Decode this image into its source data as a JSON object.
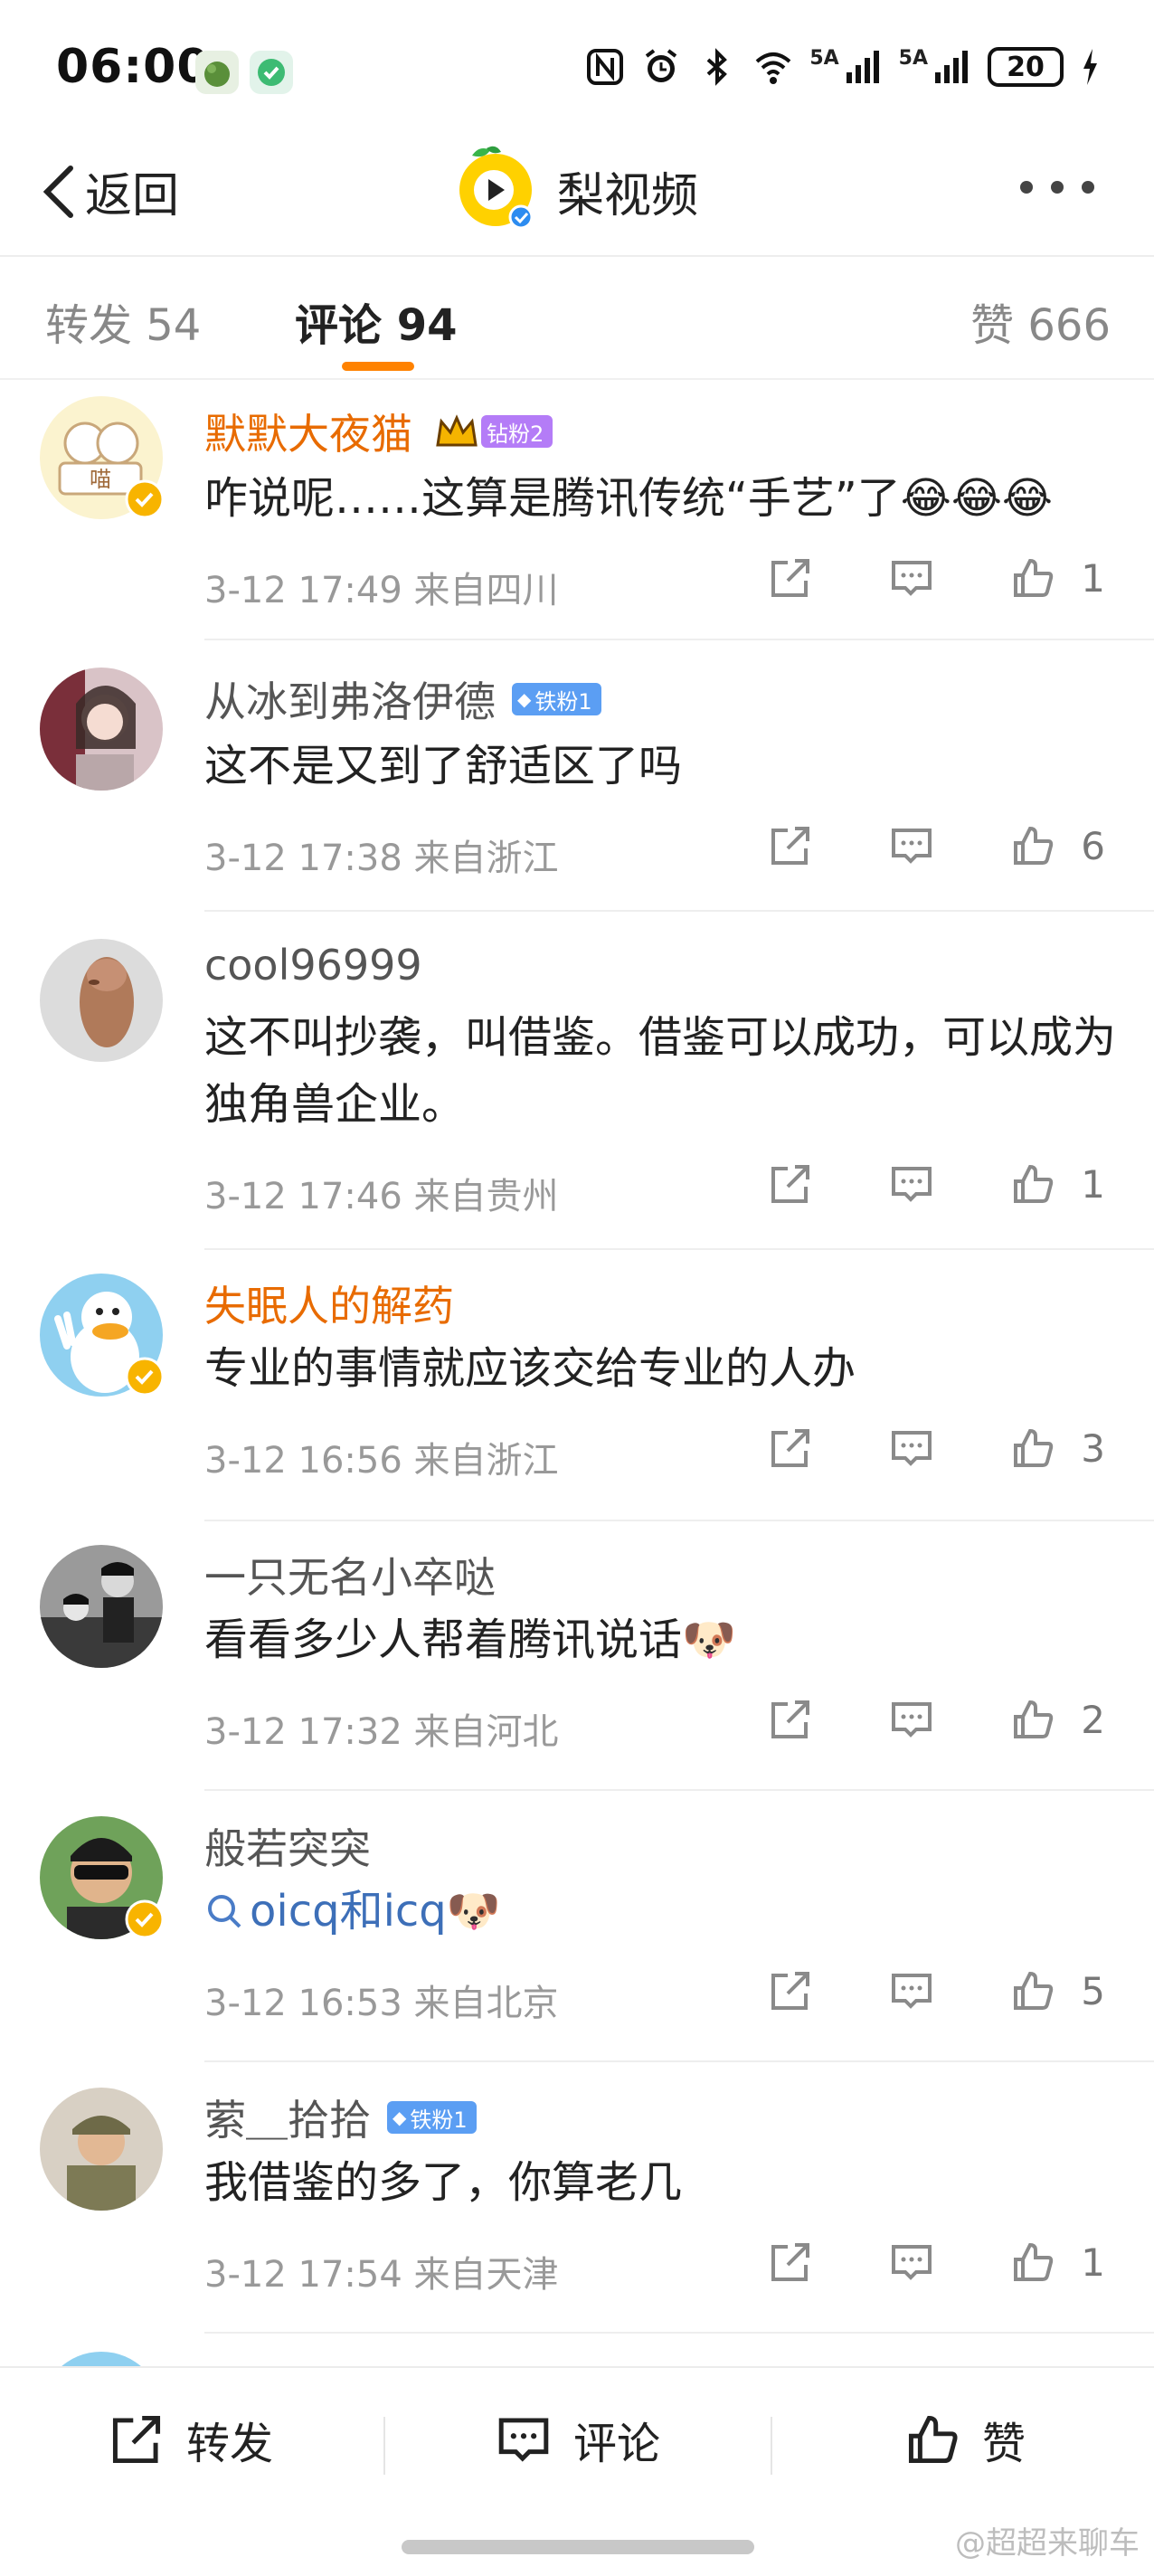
{
  "status_bar": {
    "time": "06:00",
    "network_label": "5A",
    "battery": "20"
  },
  "nav": {
    "back_label": "返回",
    "title": "梨视频"
  },
  "tabs": {
    "repost": "转发 54",
    "comment": "评论 94",
    "like": "赞 666"
  },
  "comments": [
    {
      "user": "默默大夜猫",
      "badge": "钻粉2",
      "text": "咋说呢……这算是腾讯传统“手艺”了😂😂😂",
      "meta": "3-12 17:49 来自四川",
      "likes": "1"
    },
    {
      "user": "从冰到弗洛伊德",
      "badge": "铁粉1",
      "text": "这不是又到了舒适区了吗",
      "meta": "3-12 17:38 来自浙江",
      "likes": "6"
    },
    {
      "user": "cool96999",
      "badge": "",
      "text": "这不叫抄袭，叫借鉴。借鉴可以成功，可以成为独角兽企业。",
      "meta": "3-12 17:46 来自贵州",
      "likes": "1"
    },
    {
      "user": "失眠人的解药",
      "badge": "",
      "text": "专业的事情就应该交给专业的人办",
      "meta": "3-12 16:56 来自浙江",
      "likes": "3"
    },
    {
      "user": "一只无名小卒哒",
      "badge": "",
      "text": "看看多少人帮着腾讯说话🐶",
      "meta": "3-12 17:32 来自河北",
      "likes": "2"
    },
    {
      "user": "般若突突",
      "badge": "",
      "text": "oicq和icq🐶",
      "meta": "3-12 16:53 来自北京",
      "likes": "5"
    },
    {
      "user": "萦＿拾拾",
      "badge": "铁粉1",
      "text": "我借鉴的多了，你算老几",
      "meta": "3-12 17:54 来自天津",
      "likes": "1"
    }
  ],
  "bottom_bar": {
    "repost": "转发",
    "comment": "评论",
    "like": "赞"
  },
  "watermark": "@超超来聊车",
  "colors": {
    "accent": "#ff8200",
    "username_vip": "#e86b00",
    "iron_fan": "#5b9ef3",
    "diamond_fan": "#b47cf7"
  }
}
